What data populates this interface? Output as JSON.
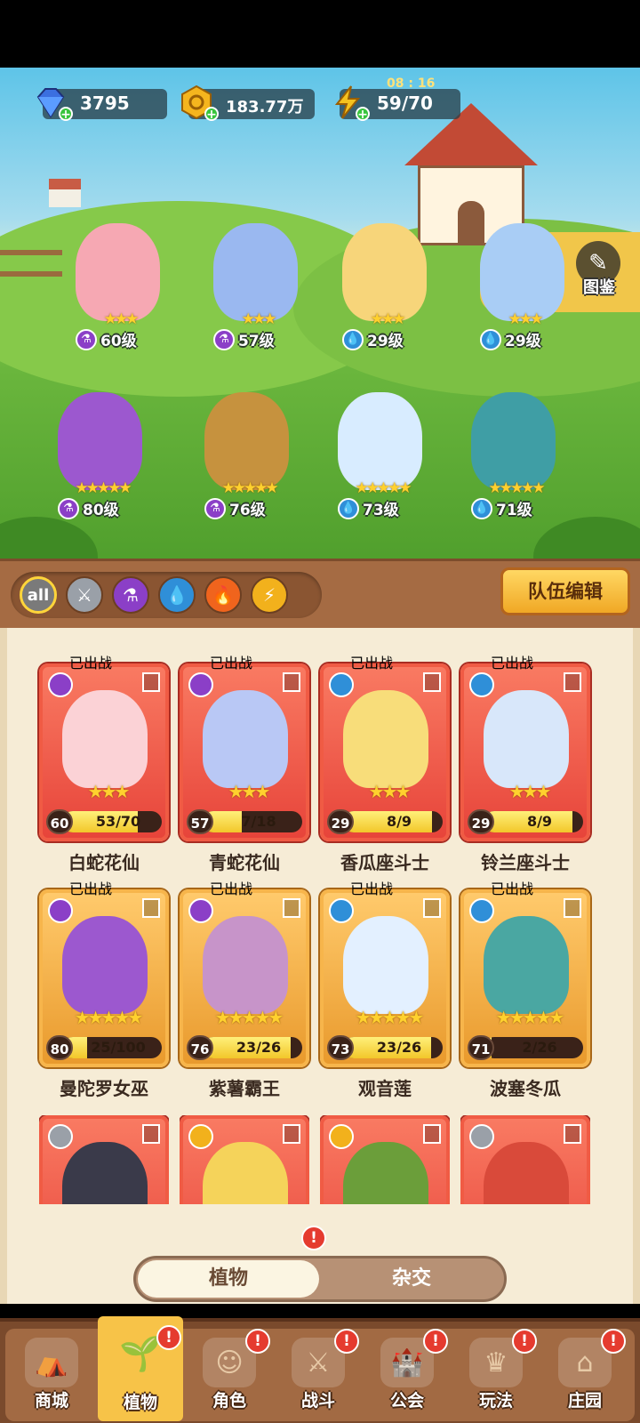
{
  "currency": {
    "gems": "3795",
    "gold": "183.77万",
    "energy": "59/70",
    "energy_timer": "08 : 16"
  },
  "atlas_label": "图鉴",
  "field_characters": [
    {
      "level": "60级",
      "stars": "★★★",
      "element": "poison"
    },
    {
      "level": "57级",
      "stars": "★★★",
      "element": "poison"
    },
    {
      "level": "29级",
      "stars": "★★★",
      "element": "water"
    },
    {
      "level": "29级",
      "stars": "★★★",
      "element": "water"
    },
    {
      "level": "80级",
      "stars": "★★★★★",
      "element": "poison"
    },
    {
      "level": "76级",
      "stars": "★★★★★",
      "element": "poison"
    },
    {
      "level": "73级",
      "stars": "★★★★★",
      "element": "water"
    },
    {
      "level": "71级",
      "stars": "★★★★★",
      "element": "water"
    }
  ],
  "filters": {
    "all_label": "all",
    "icons": [
      "sword-icon",
      "poison-flask-icon",
      "water-drop-icon",
      "fire-icon",
      "lightning-icon"
    ]
  },
  "team_edit_label": "队伍编辑",
  "deployed_label": "已出战",
  "cards": [
    {
      "name": "白蛇花仙",
      "level": "60",
      "progress": "53/70",
      "progress_fraction": 0.757,
      "stars": "★★★",
      "rarity": "red",
      "element": "poison"
    },
    {
      "name": "青蛇花仙",
      "level": "57",
      "progress": "7/18",
      "progress_fraction": 0.389,
      "stars": "★★★",
      "rarity": "red",
      "element": "poison"
    },
    {
      "name": "香瓜座斗士",
      "level": "29",
      "progress": "8/9",
      "progress_fraction": 0.889,
      "stars": "★★★",
      "rarity": "red",
      "element": "water"
    },
    {
      "name": "铃兰座斗士",
      "level": "29",
      "progress": "8/9",
      "progress_fraction": 0.889,
      "stars": "★★★",
      "rarity": "red",
      "element": "water"
    },
    {
      "name": "曼陀罗女巫",
      "level": "80",
      "progress": "25/100",
      "progress_fraction": 0.25,
      "stars": "★★★★★",
      "rarity": "gold",
      "element": "poison"
    },
    {
      "name": "紫薯霸王",
      "level": "76",
      "progress": "23/26",
      "progress_fraction": 0.885,
      "stars": "★★★★★",
      "rarity": "gold",
      "element": "poison"
    },
    {
      "name": "观音莲",
      "level": "73",
      "progress": "23/26",
      "progress_fraction": 0.885,
      "stars": "★★★★★",
      "rarity": "gold",
      "element": "water"
    },
    {
      "name": "波塞冬瓜",
      "level": "71",
      "progress": "2/26",
      "progress_fraction": 0.077,
      "stars": "★★★★★",
      "rarity": "gold",
      "element": "water"
    }
  ],
  "partial_cards": [
    {
      "rarity": "red",
      "element": "sword"
    },
    {
      "rarity": "red",
      "element": "lightning"
    },
    {
      "rarity": "red",
      "element": "lightning"
    },
    {
      "rarity": "red",
      "element": "sword"
    }
  ],
  "tabs": {
    "plants": "植物",
    "hybrid": "杂交",
    "alert": "!"
  },
  "nav": [
    {
      "label": "商城",
      "icon": "shop-icon",
      "alert": false
    },
    {
      "label": "植物",
      "icon": "plant-icon",
      "alert": true,
      "active": true
    },
    {
      "label": "角色",
      "icon": "character-icon",
      "alert": true
    },
    {
      "label": "战斗",
      "icon": "battle-icon",
      "alert": true
    },
    {
      "label": "公会",
      "icon": "guild-icon",
      "alert": true
    },
    {
      "label": "玩法",
      "icon": "gameplay-icon",
      "alert": true
    },
    {
      "label": "庄园",
      "icon": "manor-icon",
      "alert": true
    }
  ],
  "colors": {
    "poison": "#8b3fc7",
    "water": "#2f8fd8",
    "sword": "#9aa0a8",
    "lightning": "#f2b11c",
    "fire": "#f0641d",
    "accent_gold": "#f7c348",
    "card_red": "#e7443a",
    "card_gold": "#e99a2d"
  }
}
